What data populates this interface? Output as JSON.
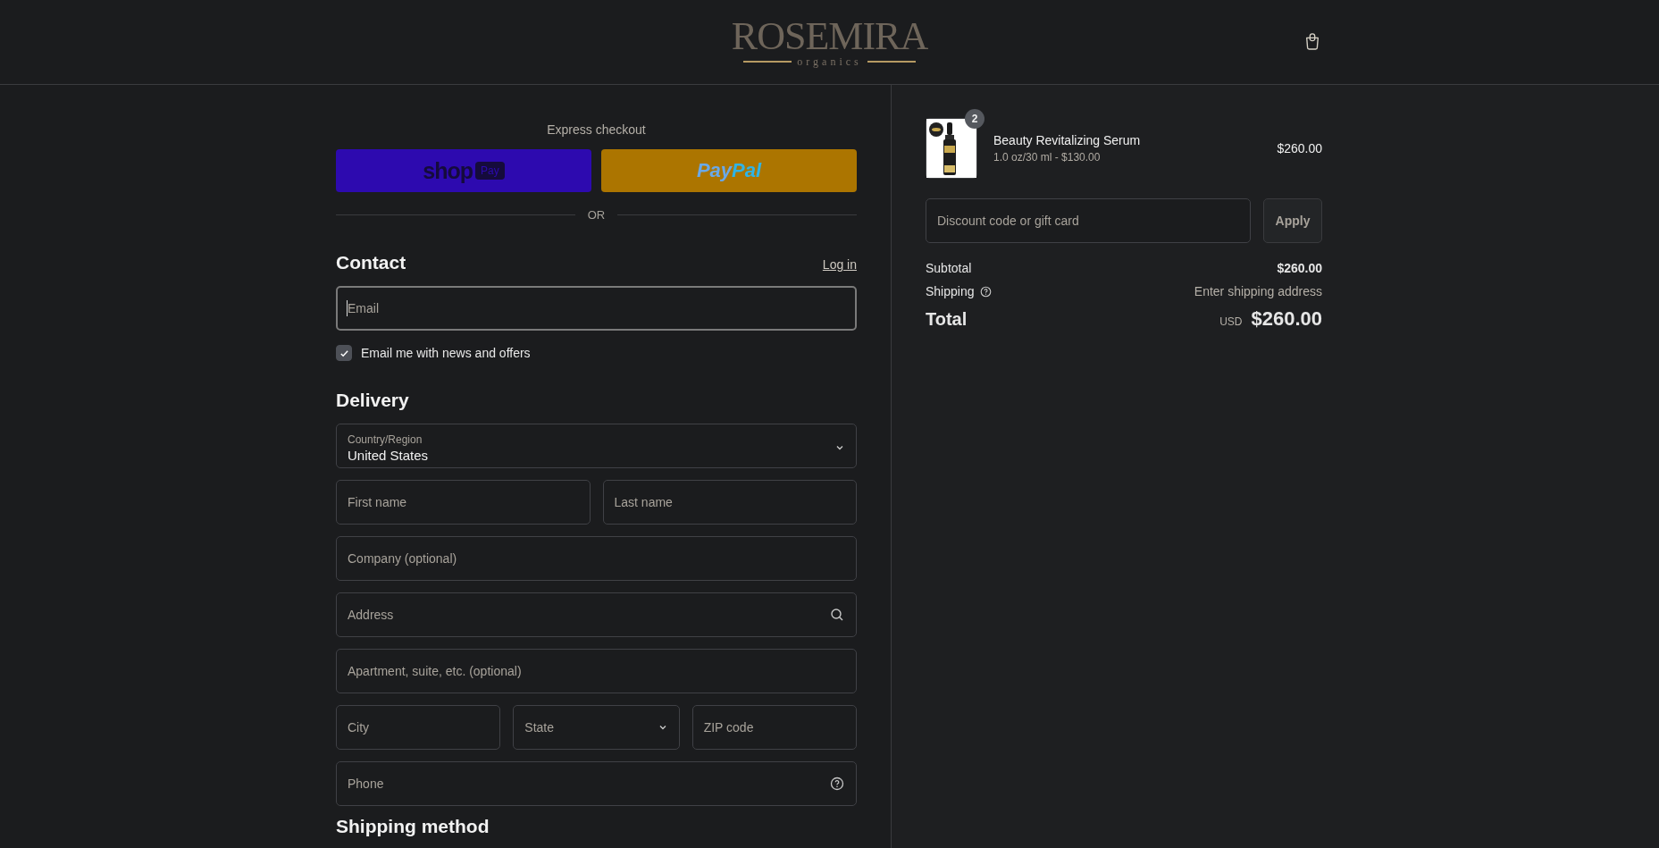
{
  "header": {
    "logo": {
      "name": "ROSEMIRA",
      "tagline": "organics"
    }
  },
  "express": {
    "title": "Express checkout",
    "buttons": [
      {
        "kind": "shop_pay",
        "label": "shop",
        "badge": "Pay"
      },
      {
        "kind": "paypal",
        "label": "Pay",
        "label_2": "Pal"
      }
    ],
    "divider": "OR"
  },
  "contact": {
    "heading": "Contact",
    "login_link": "Log in",
    "email": {
      "placeholder": "Email"
    },
    "newsletter": {
      "label": "Email me with news and offers",
      "checked": true
    }
  },
  "delivery": {
    "heading": "Delivery",
    "rows": [
      [
        {
          "kind": "select_labeled",
          "label": "Country/Region",
          "value": "United States"
        }
      ],
      [
        {
          "kind": "text",
          "placeholder": "First name"
        },
        {
          "kind": "text",
          "placeholder": "Last name"
        }
      ],
      [
        {
          "kind": "text",
          "placeholder": "Company (optional)"
        }
      ],
      [
        {
          "kind": "search",
          "placeholder": "Address"
        }
      ],
      [
        {
          "kind": "text",
          "placeholder": "Apartment, suite, etc. (optional)"
        }
      ],
      [
        {
          "kind": "text",
          "placeholder": "City"
        },
        {
          "kind": "select",
          "placeholder": "State"
        },
        {
          "kind": "text",
          "placeholder": "ZIP code"
        }
      ],
      [
        {
          "kind": "help",
          "placeholder": "Phone"
        }
      ]
    ]
  },
  "shipping_method": {
    "heading": "Shipping method"
  },
  "summary": {
    "items": [
      {
        "name": "Beauty Revitalizing Serum",
        "variant": "1.0 oz/30 ml - $130.00",
        "price": "$260.00",
        "quantity": "2"
      }
    ],
    "discount": {
      "placeholder": "Discount code or gift card",
      "button": "Apply"
    },
    "subtotal": {
      "label": "Subtotal",
      "value": "$260.00"
    },
    "shipping": {
      "label": "Shipping",
      "value": "Enter shipping address"
    },
    "total": {
      "label": "Total",
      "currency": "USD",
      "value": "$260.00"
    }
  }
}
